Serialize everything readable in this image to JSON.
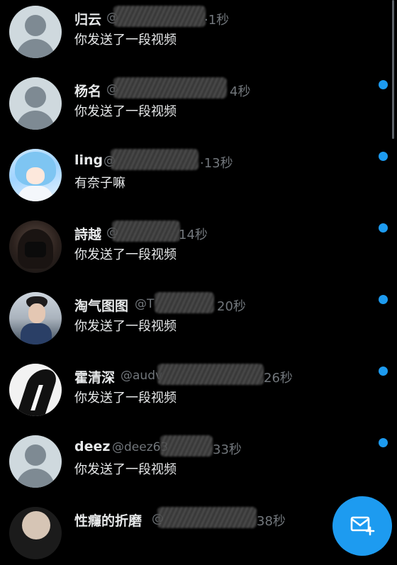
{
  "conversations": [
    {
      "name": "归云",
      "handle": "@",
      "time": "·1秒",
      "message": "你发送了一段视频",
      "unread": false,
      "avatar": "default-avatar-icon"
    },
    {
      "name": "杨名",
      "handle": "@",
      "time": "4秒",
      "message": "你发送了一段视频",
      "unread": true,
      "avatar": "default-avatar-icon"
    },
    {
      "name": "ling",
      "handle": "@",
      "time": "·13秒",
      "message": "有奈子嘛",
      "unread": true,
      "avatar": "anime-girl-photo"
    },
    {
      "name": "詩越",
      "handle": "@",
      "time": "14秒",
      "message": "你发送了一段视频",
      "unread": true,
      "avatar": "masked-person-photo"
    },
    {
      "name": "淘气图图",
      "handle": "@T",
      "time": "20秒",
      "message": "你发送了一段视频",
      "unread": true,
      "avatar": "boy-photo"
    },
    {
      "name": "霍清深",
      "handle": "@audv",
      "time": "26秒",
      "message": "你发送了一段视频",
      "unread": true,
      "avatar": "bw-figure-photo"
    },
    {
      "name": "deez",
      "handle": "@deez63",
      "time": "33秒",
      "message": "你发送了一段视频",
      "unread": true,
      "avatar": "default-avatar-icon"
    },
    {
      "name": "性癮的折磨",
      "handle": "@",
      "time": "38秒",
      "message": "",
      "unread": false,
      "avatar": "person-photo"
    }
  ],
  "fab": {
    "icon": "new-message-icon"
  },
  "colors": {
    "accent": "#1d9bf0",
    "background": "#000000",
    "muted": "#71767b",
    "text": "#e7e9ea"
  }
}
